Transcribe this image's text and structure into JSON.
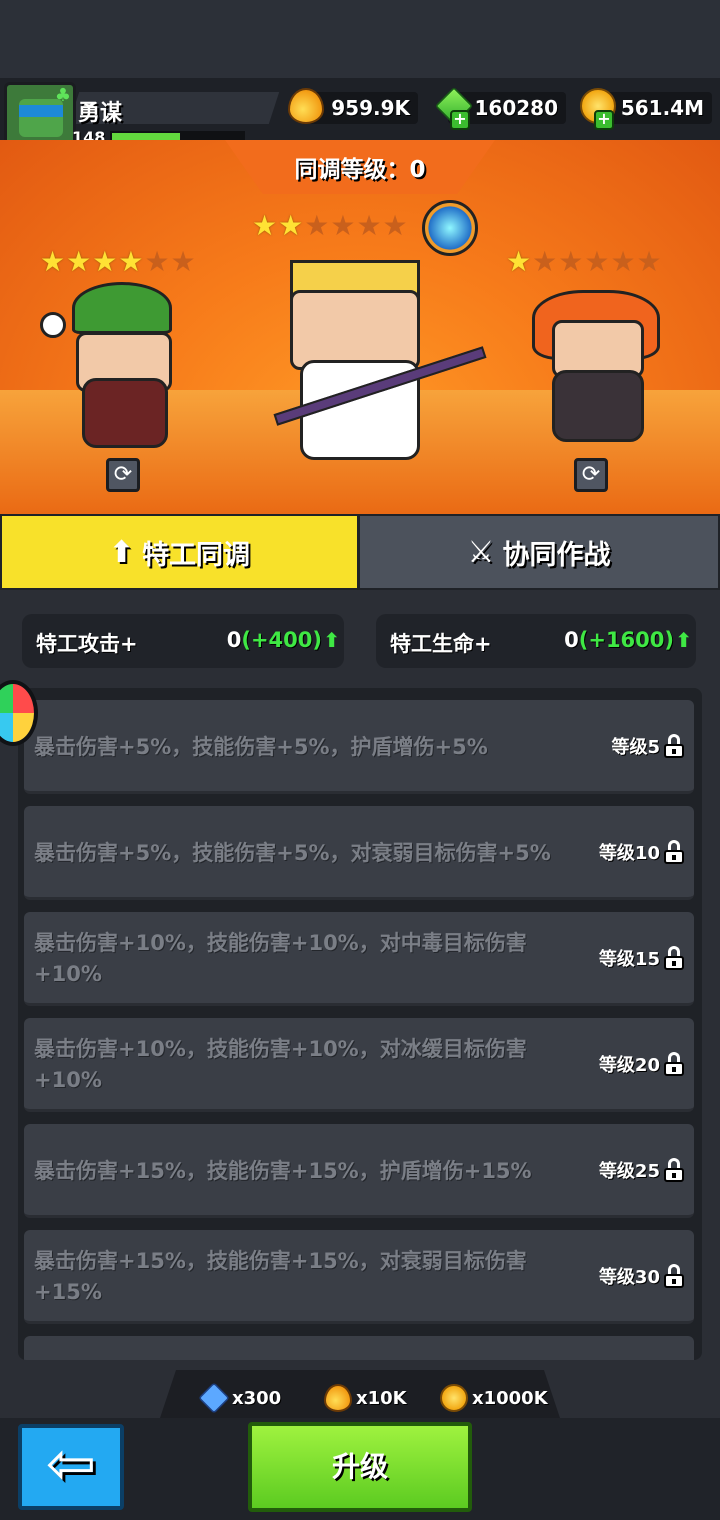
{
  "player": {
    "name": "勇谋",
    "level": "148",
    "xp_fraction": 0.52
  },
  "resources": [
    {
      "icon": "fire-drop-icon",
      "value": "959.9K"
    },
    {
      "icon": "green-gem-icon",
      "value": "160280"
    },
    {
      "icon": "gold-coin-icon",
      "value": "561.4M"
    }
  ],
  "sync": {
    "title": "同调等级：0"
  },
  "heroes": [
    {
      "name": "elf-hat-hero",
      "stars_on": 4,
      "stars_total": 6
    },
    {
      "name": "blonde-staff-hero",
      "stars_on": 2,
      "stars_total": 6
    },
    {
      "name": "redhead-hero",
      "stars_on": 1,
      "stars_total": 6
    }
  ],
  "tabs": {
    "sync_label": "特工同调",
    "battle_label": "协同作战"
  },
  "stats": {
    "attack_label": "特工攻击+",
    "attack_value": "0",
    "attack_bonus": "(+400)",
    "hp_label": "特工生命+",
    "hp_value": "0",
    "hp_bonus": "(+1600)"
  },
  "perks": [
    {
      "text": "暴击伤害+5%，技能伤害+5%，护盾增伤+5%",
      "level": "等级5"
    },
    {
      "text": "暴击伤害+5%，技能伤害+5%，对衰弱目标伤害+5%",
      "level": "等级10"
    },
    {
      "text": "暴击伤害+10%，技能伤害+10%，对中毒目标伤害+10%",
      "level": "等级15"
    },
    {
      "text": "暴击伤害+10%，技能伤害+10%，对冰缓目标伤害+10%",
      "level": "等级20"
    },
    {
      "text": "暴击伤害+15%，技能伤害+15%，护盾增伤+15%",
      "level": "等级25"
    },
    {
      "text": "暴击伤害+15%，技能伤害+15%，对衰弱目标伤害+15%",
      "level": "等级30"
    }
  ],
  "costs": [
    {
      "icon": "puzzle-icon",
      "value": "x300"
    },
    {
      "icon": "fire-drop-icon",
      "value": "x10K"
    },
    {
      "icon": "gold-coin-icon",
      "value": "x1000K"
    }
  ],
  "buttons": {
    "back_glyph": "⇦",
    "upgrade_label": "升级"
  }
}
